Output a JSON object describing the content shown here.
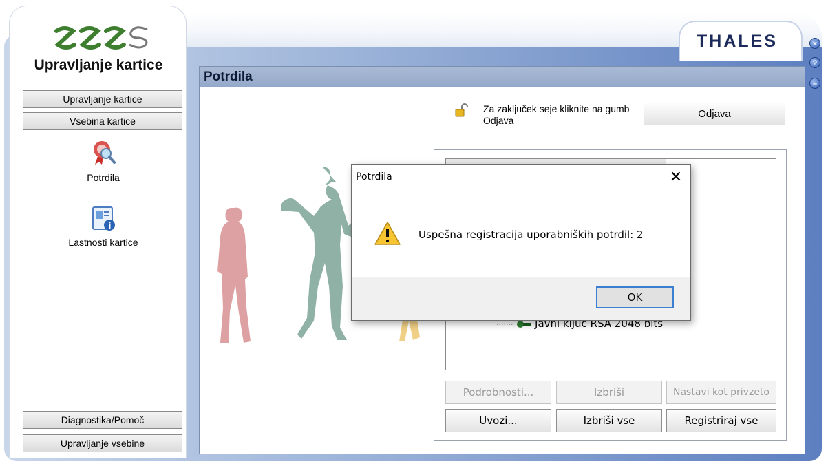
{
  "app": {
    "title": "Upravljanje kartice",
    "brand": "THALES",
    "window_controls": [
      "close",
      "help",
      "minimize"
    ]
  },
  "sidebar": {
    "top_buttons": [
      {
        "label": "Upravljanje kartice"
      },
      {
        "label": "Vsebina kartice"
      }
    ],
    "items": [
      {
        "label": "Potrdila",
        "icon": "certificate-search-icon"
      },
      {
        "label": "Lastnosti kartice",
        "icon": "card-properties-icon"
      }
    ],
    "bottom_buttons": [
      {
        "label": "Diagnostika/Pomoč"
      },
      {
        "label": "Upravljanje vsebine"
      }
    ]
  },
  "main": {
    "header": "Potrdila",
    "logout_note": "Za zaključek seje kliknite na gumb Odjava",
    "logout_button": "Odjava",
    "tree_item": "Javni ključ RSA 2048 bits",
    "buttons_row1": [
      {
        "label": "Podrobnosti...",
        "enabled": false
      },
      {
        "label": "Izbriši",
        "enabled": false
      },
      {
        "label": "Nastavi kot privzeto",
        "enabled": false
      }
    ],
    "buttons_row2": [
      {
        "label": "Uvozi...",
        "enabled": true
      },
      {
        "label": "Izbriši vse",
        "enabled": true
      },
      {
        "label": "Registriraj vse",
        "enabled": true
      }
    ]
  },
  "dialog": {
    "title": "Potrdila",
    "message": "Uspešna registracija uporabniških potrdil: 2",
    "ok_label": "OK",
    "close_glyph": "✕",
    "icon": "warning-icon"
  },
  "colors": {
    "header_bg": "#a9bad5",
    "frame_blue": "#5d7fc0",
    "ok_focus": "#3c7fd1"
  }
}
